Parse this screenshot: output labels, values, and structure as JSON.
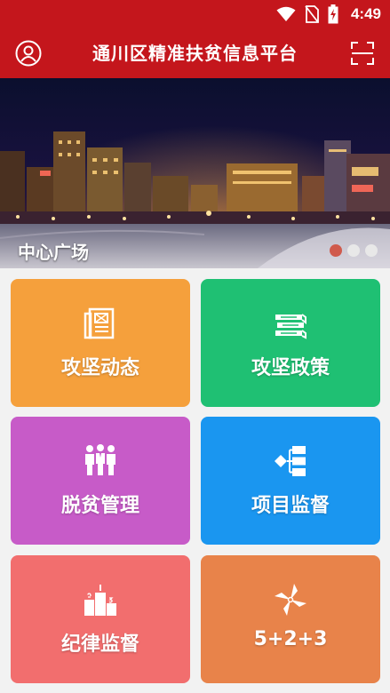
{
  "status_bar": {
    "time": "4:49",
    "icons": [
      "wifi-icon",
      "no-sim-icon",
      "battery-charging-icon"
    ]
  },
  "app_bar": {
    "title": "通川区精准扶贫信息平台",
    "left_icon": "user-avatar-icon",
    "right_icon": "scan-icon"
  },
  "banner": {
    "caption": "中心广场",
    "slide_count": 3,
    "active_slide": 1
  },
  "tiles": [
    {
      "label": "攻坚动态",
      "icon": "news-icon",
      "color": "#f5a03c"
    },
    {
      "label": "攻坚政策",
      "icon": "books-icon",
      "color": "#1fc073"
    },
    {
      "label": "脱贫管理",
      "icon": "people-icon",
      "color": "#c75bc8"
    },
    {
      "label": "项目监督",
      "icon": "flow-icon",
      "color": "#1a96f0"
    },
    {
      "label": "纪律监督",
      "icon": "podium-icon",
      "color": "#f26e6e"
    },
    {
      "label": "5+2+3",
      "icon": "windmill-icon",
      "color": "#e8834a"
    }
  ],
  "colors": {
    "primary": "#c4161c",
    "background": "#f2f2f2",
    "dot_active": "#d05a4c",
    "dot_inactive": "#e8e8e8"
  }
}
